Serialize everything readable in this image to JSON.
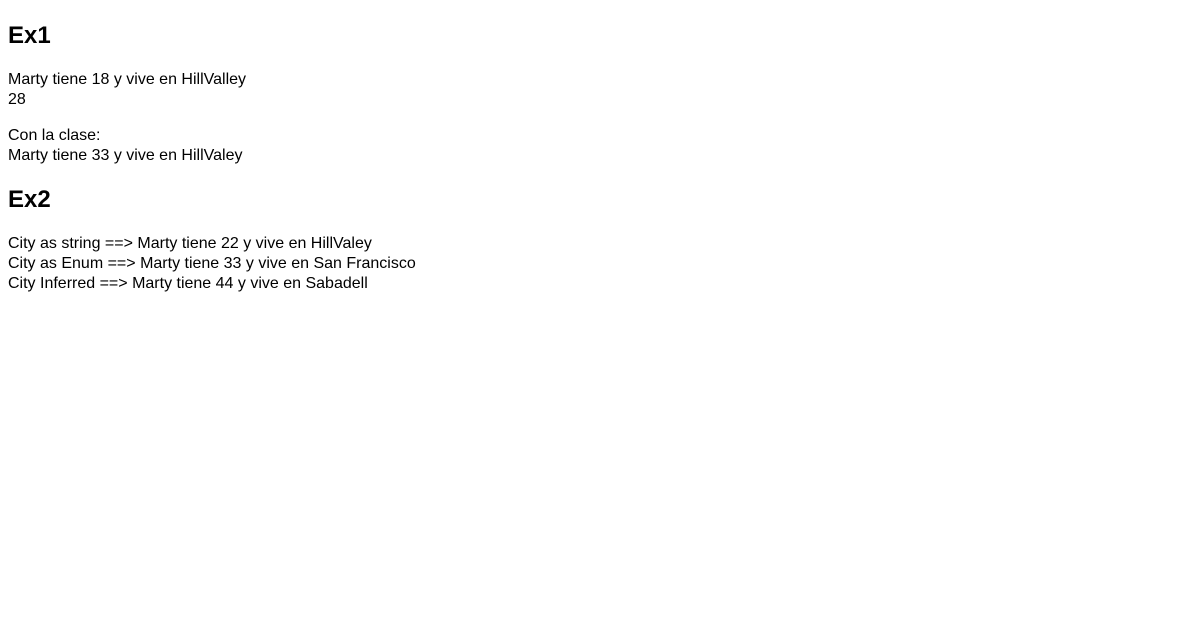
{
  "sections": {
    "ex1": {
      "heading": "Ex1",
      "para1_line1": "Marty tiene 18 y vive en HillValley",
      "para1_line2": "28",
      "para2_line1": "Con la clase:",
      "para2_line2": "Marty tiene 33 y vive en HillValey"
    },
    "ex2": {
      "heading": "Ex2",
      "line1": "City as string ==> Marty tiene 22 y vive en HillValey",
      "line2": "City as Enum ==> Marty tiene 33 y vive en San Francisco",
      "line3": "City Inferred ==> Marty tiene 44 y vive en Sabadell"
    }
  }
}
